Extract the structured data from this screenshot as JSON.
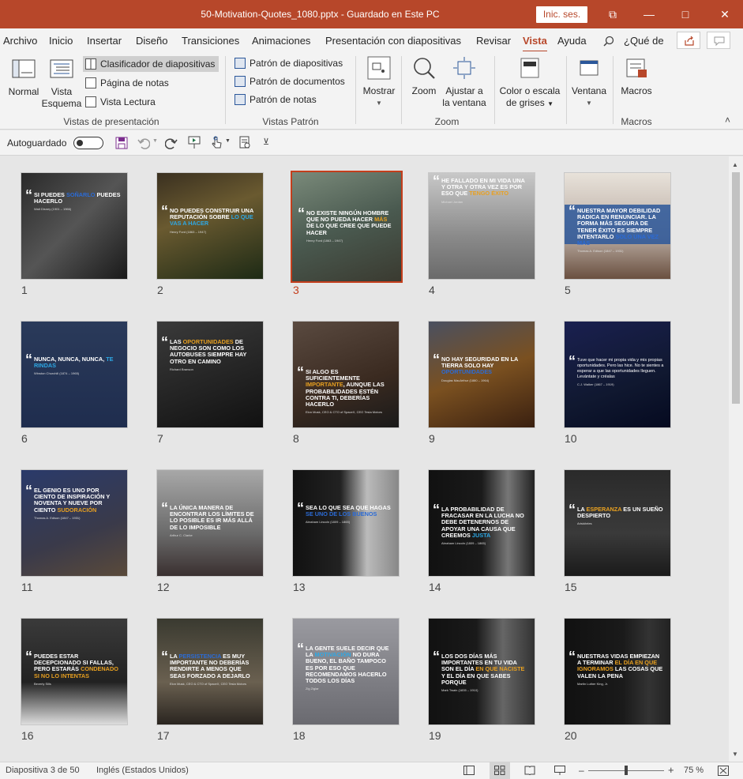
{
  "window": {
    "title": "50-Motivation-Quotes_1080.pptx  -  Guardado en Este PC",
    "signin": "Inic. ses.",
    "min_glyph": "—",
    "restore_glyph": "□",
    "close_glyph": "✕",
    "ribbon_display_glyph": "⧉",
    "accent": "#b7472a"
  },
  "tabs": [
    "Archivo",
    "Inicio",
    "Insertar",
    "Diseño",
    "Transiciones",
    "Animaciones",
    "Presentación con diapositivas",
    "Revisar",
    "Vista",
    "Ayuda"
  ],
  "active_tab": "Vista",
  "tellme": "¿Qué de",
  "ribbon": {
    "normal": "Normal",
    "esquema1": "Vista",
    "esquema2": "Esquema",
    "clasificador": "Clasificador de diapositivas",
    "pagina_notas": "Página de notas",
    "lectura": "Vista Lectura",
    "group_presentacion": "Vistas de presentación",
    "patron_diap": "Patrón de diapositivas",
    "patron_doc": "Patrón de documentos",
    "patron_notas": "Patrón de notas",
    "group_patron": "Vistas Patrón",
    "mostrar": "Mostrar",
    "zoom": "Zoom",
    "ajustar1": "Ajustar a",
    "ajustar2": "la ventana",
    "group_zoom": "Zoom",
    "color1": "Color o escala",
    "color2": "de grises",
    "ventana": "Ventana",
    "macros": "Macros",
    "group_macros": "Macros",
    "caret": "˄"
  },
  "qat": {
    "autosave": "Autoguardado",
    "more_glyph": "⊻"
  },
  "slides": [
    {
      "n": "1",
      "text": "Si puedes soñarlo puedes hacerlo",
      "hl": "soñarlo",
      "auth": "Walt Disney (1901 – 1966)",
      "bg": "linear-gradient(135deg,#2a2a2a,#555 50%,#1a1a1a)",
      "y": "24"
    },
    {
      "n": "2",
      "text": "No puedes construir una reputación sobre lo que vas a hacer",
      "hl": "lo que vas a hacer",
      "auth": "Henry Ford (1863 – 1947)",
      "bg": "linear-gradient(160deg,#3a3020,#6a5a30 40%,#1d2a15)",
      "y": "44"
    },
    {
      "n": "3",
      "text": "No existe ningún hombre que no pueda hacer más de lo que cree que puede hacer",
      "hl": "más",
      "auth": "Henry Ford (1863 – 1947)",
      "bg": "linear-gradient(160deg,#7a8a7a,#4a5a50 50%,#3a3a30)",
      "y": "46"
    },
    {
      "n": "4",
      "text": "He fallado en mi vida una y otra y otra vez es por eso que tengo éxito",
      "hl": "tengo éxito",
      "auth": "Michael Jordan",
      "bg": "linear-gradient(180deg,#c8c8c8,#8a8a8a 60%,#6a6a6a)",
      "y": "6"
    },
    {
      "n": "5",
      "text": "Nuestra mayor debilidad radica en renunciar. La forma más segura de tener éxito es siempre intentarlo solo una vez más",
      "hl": "solo una vez más",
      "auth": "Thomas A. Edison (1847 – 1931)",
      "bg": "linear-gradient(180deg,#e8e2da,#b8aaa0 60%,#6a5040)",
      "y": "44",
      "box": "1"
    },
    {
      "n": "6",
      "text": "Nunca, nunca, nunca, te rindas",
      "hl": "te rindas",
      "auth": "Winston Churchill (1874 – 1965)",
      "bg": "linear-gradient(180deg,#2a3a5a,#1f2d4e)",
      "y": "44"
    },
    {
      "n": "7",
      "text": "Las oportunidades de negocio son como los autobuses siempre hay otro en camino",
      "hl": "oportunidades",
      "auth": "Richard Branson",
      "bg": "linear-gradient(160deg,#3a3a3a,#222 60%,#111)",
      "y": "22"
    },
    {
      "n": "8",
      "text": "Si algo es suficientemente importante, aunque las probabilidades estén contra ti, deberías hacerlo",
      "hl": "importante",
      "auth": "Elon Musk, CEO & CTO of SpaceX, CEO Tesla Motors",
      "bg": "linear-gradient(160deg,#5a4a40,#3a2a20 60%,#1a1a1a)",
      "y": "60"
    },
    {
      "n": "9",
      "text": "No hay seguridad en la tierra solo hay oportunidades",
      "hl": "oportunidades",
      "auth": "Douglas MacArthur (1880 – 1964)",
      "bg": "linear-gradient(160deg,#4a5060,#7a5020 50%,#3a2010)",
      "y": "44"
    },
    {
      "n": "10",
      "text": "Tuve que hacer mi propia vida y mis propias oportunidades. Pero las hice. No te sientes a esperar a que las oportunidades lleguen. Levántate y créalas",
      "hl": "",
      "auth": "C.J. Walker (1867 – 1919)",
      "bg": "linear-gradient(160deg,#1a2050,#101830 60%,#050a20)",
      "y": "46",
      "plain": "1"
    },
    {
      "n": "11",
      "text": "El genio es uno por ciento de inspiración y noventa y nueve por ciento sudoración",
      "hl": "sudoración",
      "auth": "Thomas A. Edison (1847 – 1931)",
      "bg": "linear-gradient(160deg,#2a3a6a,#3a3a4a 60%,#5a4a3a)",
      "y": "22"
    },
    {
      "n": "12",
      "text": "La única manera de encontrar los límites de lo posible es ir más allá de lo imposible",
      "hl": "",
      "auth": "Arthur C. Clarke",
      "bg": "linear-gradient(180deg,#a8a8a8,#6a6a6a 60%,#3a3030)",
      "y": "44"
    },
    {
      "n": "13",
      "text": "Sea lo que sea que hagas se uno de los buenos",
      "hl": "se uno de los buenos",
      "auth": "Abraham Lincoln (1809 – 1865)",
      "bg": "linear-gradient(90deg,#111,#222 45%,#bbb 70%,#888)",
      "y": "44"
    },
    {
      "n": "14",
      "text": "La probabilidad de fracasar en la lucha no debe detenernos de apoyar una causa que creemos justa",
      "hl": "justa",
      "auth": "Abraham Lincoln (1809 – 1865)",
      "bg": "linear-gradient(90deg,#111,#1a1a1a 50%,#777 75%,#222)",
      "y": "46"
    },
    {
      "n": "15",
      "text": "La esperanza es un sueño despierto",
      "hl": "esperanza",
      "auth": "Aristóteles",
      "bg": "linear-gradient(180deg,#2a2a2a,#3a3a3a 60%,#1a1a1a)",
      "y": "46"
    },
    {
      "n": "16",
      "text": "Puedes estar decepcionado si fallas, pero estarás condenado si no lo intentas",
      "hl": "condenado si no lo intentas",
      "auth": "Beverly Sills",
      "bg": "linear-gradient(180deg,#3a3a3a,#222 60%,#ddd)",
      "y": "44"
    },
    {
      "n": "17",
      "text": "La persistencia es muy importante no deberías rendirte a menos que seas forzado a dejarlo",
      "hl": "persistencia",
      "auth": "Elon Musk, CEO & CTO of SpaceX, CEO Tesla Motors",
      "bg": "linear-gradient(180deg,#3a3a30,#6a6050 60%,#2a2520)",
      "y": "44"
    },
    {
      "n": "18",
      "text": "La gente suele decir que la motivación no dura bueno, el baño tampoco es por eso que recomendamos hacerlo todos los días",
      "hl": "motivación",
      "auth": "Zig Ziglar",
      "bg": "linear-gradient(180deg,#9a9aa0,#6a6a70)",
      "y": "34"
    },
    {
      "n": "19",
      "text": "Los dos días más importantes en tu vida son el día en que naciste y el día en que sabes porque",
      "hl": "en que naciste",
      "auth": "Mark Twain (1835 – 1910)",
      "bg": "linear-gradient(90deg,#111,#1a1a1a 45%,#666 70%,#333)",
      "y": "44"
    },
    {
      "n": "20",
      "text": "Nuestras vidas empiezan a terminar el día en que ignoramos las cosas que valen la pena",
      "hl": "el día en que ignoramos",
      "auth": "Martin Luther King, Jr.",
      "bg": "linear-gradient(90deg,#111,#1a1a1a 55%,#333 80%,#222)",
      "y": "44"
    }
  ],
  "selected_slide": "3",
  "status": {
    "slide": "Diapositiva 3 de 50",
    "lang": "Inglés (Estados Unidos)",
    "zoom_minus": "–",
    "zoom_plus": "+",
    "zoom": "75 %",
    "zoom_level": 0.5
  }
}
